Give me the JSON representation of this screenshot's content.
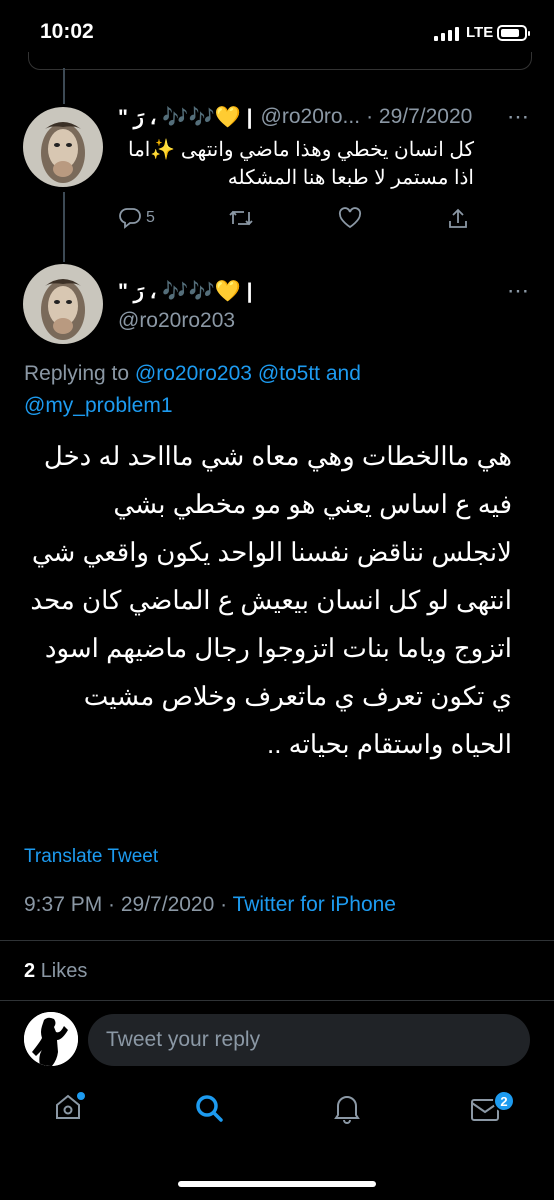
{
  "status_bar": {
    "time": "10:02",
    "network": "LTE"
  },
  "tweet_prev": {
    "display_name": "| 💛🎶🎶 ، رَ \"",
    "handle": "@ro20ro...",
    "date": "· 29/7/2020",
    "text": "كل انسان يخطي وهذا ماضي وانتهى ✨اما اذا مستمر لا طبعا هنا المشكله",
    "reply_count": "5"
  },
  "tweet_main": {
    "display_name": "| 💛🎶🎶 ، رَ \"",
    "handle": "@ro20ro203",
    "replying_label": "Replying to",
    "replying_mentions": [
      "@ro20ro203",
      "@to5tt"
    ],
    "replying_and": "and",
    "replying_last": "@my_problem1",
    "text": "هي ماالخطات وهي معاه شي ماااحد له دخل فيه ع اساس يعني هو مو مخطي بشي لانجلس نناقض نفسنا الواحد يكون واقعي شي انتهى لو كل انسان بيعيش ع الماضي كان محد اتزوج وياما بنات اتزوجوا رجال ماضيهم اسود ي تكون تعرف ي ماتعرف وخلاص مشيت الحياه واستقام بحياته ..",
    "translate_label": "Translate Tweet",
    "time": "9:37 PM · 29/7/2020 · ",
    "source": "Twitter for iPhone",
    "likes_count": "2",
    "likes_label": "Likes"
  },
  "reply_box": {
    "placeholder": "Tweet your reply"
  },
  "tab_bar": {
    "messages_badge": "2"
  },
  "colors": {
    "accent": "#1d9bf0",
    "muted": "#8b98a5",
    "heart": "#ffc94d"
  }
}
